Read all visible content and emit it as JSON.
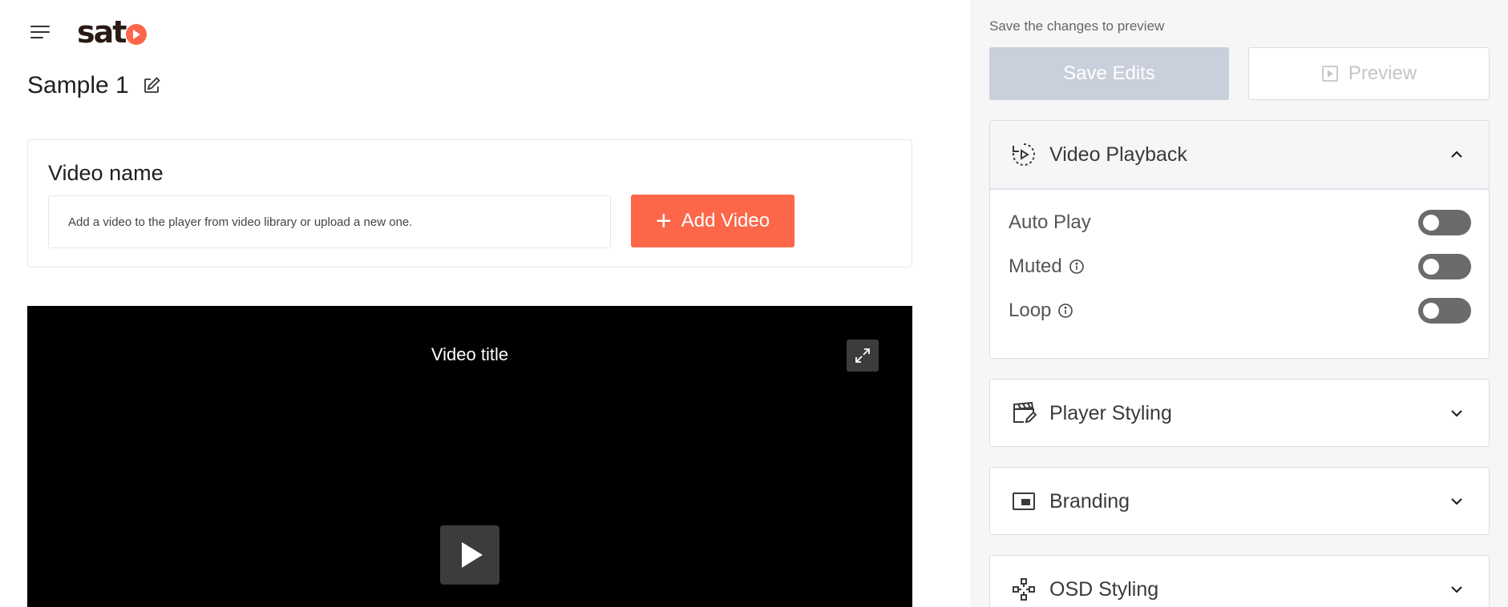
{
  "app": {
    "logo_text": "sat",
    "brand_color": "#fb6748"
  },
  "header": {
    "page_title": "Sample 1"
  },
  "video_card": {
    "label": "Video name",
    "placeholder": "Add a video to the player from video library or upload a new one.",
    "add_button_label": "Add Video"
  },
  "player": {
    "title": "Video title"
  },
  "side": {
    "hint": "Save the changes to preview",
    "save_label": "Save Edits",
    "preview_label": "Preview",
    "panels": [
      {
        "label": "Video Playback",
        "icon": "replay-icon",
        "expanded": true
      },
      {
        "label": "Player Styling",
        "icon": "clapperboard-edit-icon",
        "expanded": false
      },
      {
        "label": "Branding",
        "icon": "picture-in-picture-icon",
        "expanded": false
      },
      {
        "label": "OSD Styling",
        "icon": "gamepad-icon",
        "expanded": false
      }
    ],
    "playback_options": [
      {
        "label": "Auto Play",
        "info": false,
        "on": false
      },
      {
        "label": "Muted",
        "info": true,
        "on": false
      },
      {
        "label": "Loop",
        "info": true,
        "on": false
      }
    ]
  }
}
